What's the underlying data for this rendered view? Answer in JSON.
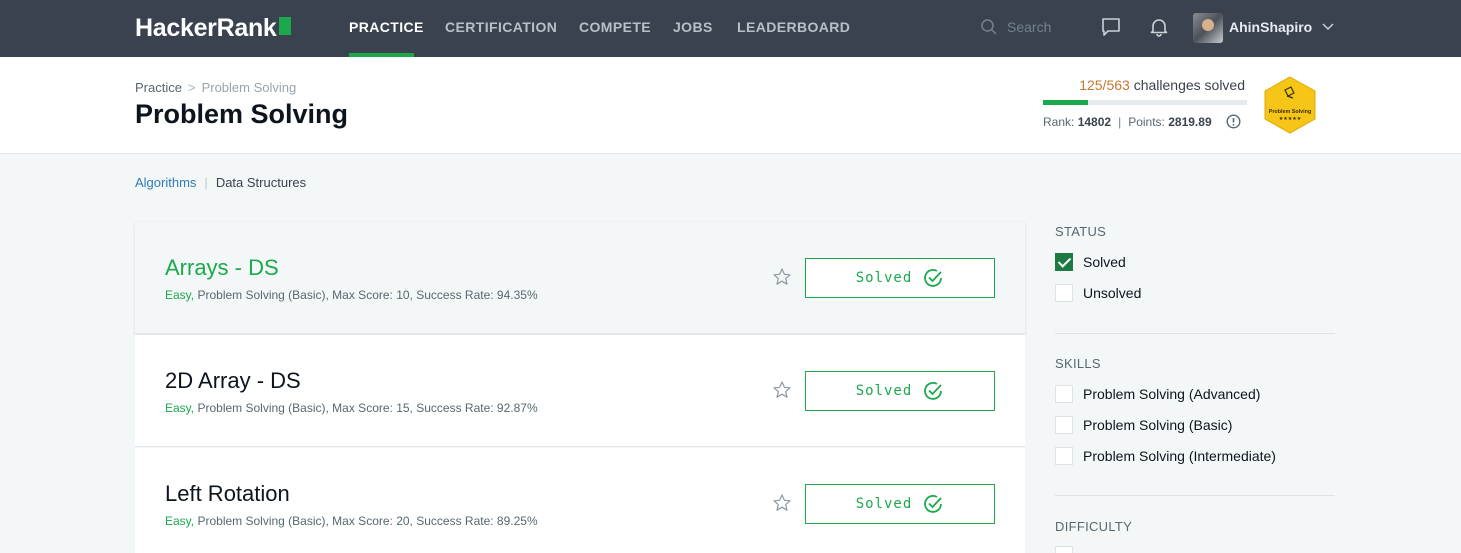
{
  "nav": {
    "logo": "HackerRank",
    "items": [
      {
        "label": "PRACTICE",
        "active": true
      },
      {
        "label": "CERTIFICATION",
        "active": false
      },
      {
        "label": "COMPETE",
        "active": false
      },
      {
        "label": "JOBS",
        "active": false
      },
      {
        "label": "LEADERBOARD",
        "active": false
      }
    ],
    "search_placeholder": "Search",
    "username": "AhinShapiro"
  },
  "header": {
    "breadcrumb": [
      "Practice",
      "Problem Solving"
    ],
    "title": "Problem Solving",
    "progress": {
      "solved_count": "125/563",
      "suffix": "challenges solved",
      "fraction": 0.222
    },
    "rank_label": "Rank:",
    "rank_value": "14802",
    "points_label": "Points:",
    "points_value": "2819.89",
    "badge_text": "Problem Solving",
    "badge_stars": "★★★★★"
  },
  "subtracks": [
    "Algorithms",
    "Data Structures"
  ],
  "challenges": [
    {
      "title": "Arrays - DS",
      "difficulty": "Easy,",
      "meta": "Problem Solving (Basic), Max Score: 10, Success Rate: 94.35%",
      "status": "Solved"
    },
    {
      "title": "2D Array - DS",
      "difficulty": "Easy,",
      "meta": "Problem Solving (Basic), Max Score: 15, Success Rate: 92.87%",
      "status": "Solved"
    },
    {
      "title": "Left Rotation",
      "difficulty": "Easy,",
      "meta": "Problem Solving (Basic), Max Score: 20, Success Rate: 89.25%",
      "status": "Solved"
    }
  ],
  "filters": {
    "status": {
      "heading": "STATUS",
      "options": [
        {
          "label": "Solved",
          "checked": true
        },
        {
          "label": "Unsolved",
          "checked": false
        }
      ]
    },
    "skills": {
      "heading": "SKILLS",
      "options": [
        {
          "label": "Problem Solving (Advanced)",
          "checked": false
        },
        {
          "label": "Problem Solving (Basic)",
          "checked": false
        },
        {
          "label": "Problem Solving (Intermediate)",
          "checked": false
        }
      ]
    },
    "difficulty": {
      "heading": "DIFFICULTY"
    }
  },
  "colors": {
    "nav_bg": "#39424e",
    "accent_green": "#1ba94c",
    "progress_orange": "#c7782e",
    "link_blue": "#2c7bb8",
    "badge_gold": "#f5c518"
  }
}
